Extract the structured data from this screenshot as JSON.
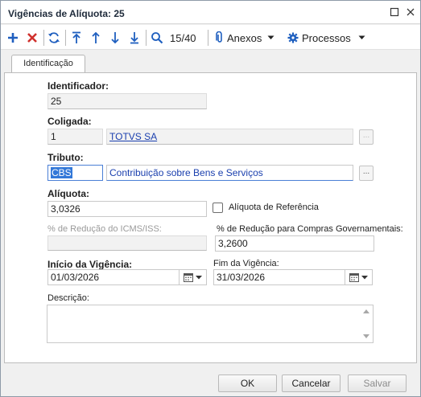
{
  "window": {
    "title": "Vigências de Alíquota: 25"
  },
  "toolbar": {
    "record_counter": "15/40",
    "attachments_label": "Anexos",
    "processes_label": "Processos"
  },
  "tabs": [
    {
      "label": "Identificação"
    }
  ],
  "form": {
    "identificador": {
      "label": "Identificador:",
      "value": "25"
    },
    "coligada": {
      "label": "Coligada:",
      "code": "1",
      "name": "TOTVS SA"
    },
    "tributo": {
      "label": "Tributo:",
      "code": "CBS",
      "name": "Contribuição sobre Bens e Serviços"
    },
    "aliquota": {
      "label": "Alíquota:",
      "value": "3,0326"
    },
    "aliquota_referencia": {
      "label": "Alíquota de Referência",
      "checked": false
    },
    "reducao_icms": {
      "label": "% de Redução do ICMS/ISS:",
      "value": ""
    },
    "reducao_compras": {
      "label": "% de Redução para Compras Governamentais:",
      "value": "3,2600"
    },
    "inicio_vigencia": {
      "label": "Início da Vigência:",
      "value": "01/03/2026"
    },
    "fim_vigencia": {
      "label": "Fim da Vigência:",
      "value": "31/03/2026"
    },
    "descricao": {
      "label": "Descrição:",
      "value": ""
    },
    "ellipsis": "..."
  },
  "footer": {
    "ok_label": "OK",
    "cancel_label": "Cancelar",
    "save_label": "Salvar"
  },
  "colors": {
    "accent_blue": "#1f5fbf",
    "delete_red": "#d0312d",
    "link_blue": "#1a3fae",
    "selection_blue": "#3378d8"
  }
}
